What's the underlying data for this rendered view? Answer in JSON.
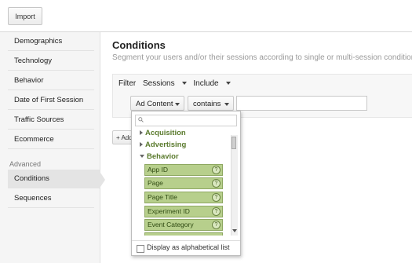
{
  "toolbar": {
    "import_label": "Import"
  },
  "sidebar": {
    "items": [
      {
        "label": "Demographics"
      },
      {
        "label": "Technology"
      },
      {
        "label": "Behavior"
      },
      {
        "label": "Date of First Session"
      },
      {
        "label": "Traffic Sources"
      },
      {
        "label": "Ecommerce"
      }
    ],
    "advanced_header": "Advanced",
    "advanced_items": [
      {
        "label": "Conditions",
        "active": true
      },
      {
        "label": "Sequences"
      }
    ]
  },
  "main": {
    "title": "Conditions",
    "subtitle": "Segment your users and/or their sessions according to single or multi-session conditions.",
    "filter": {
      "filter_label": "Filter",
      "scope_value": "Sessions",
      "mode_value": "Include"
    },
    "condition": {
      "dimension_value": "Ad Content",
      "operator_value": "contains",
      "text_value": ""
    },
    "add_button_label": "+ Add"
  },
  "dropdown": {
    "search_placeholder": "",
    "categories": [
      {
        "label": "Acquisition",
        "expanded": false
      },
      {
        "label": "Advertising",
        "expanded": false
      },
      {
        "label": "Behavior",
        "expanded": true
      }
    ],
    "behavior_items": [
      {
        "label": "App ID"
      },
      {
        "label": "Page"
      },
      {
        "label": "Page Title"
      },
      {
        "label": "Experiment ID"
      },
      {
        "label": "Event Category"
      }
    ],
    "help_glyph": "?",
    "footer_label": "Display as alphabetical list"
  },
  "colors": {
    "chip_fill": "#b7cf8c",
    "category_text": "#5a7a2d",
    "sidebar_active": "#e4e4e4"
  }
}
